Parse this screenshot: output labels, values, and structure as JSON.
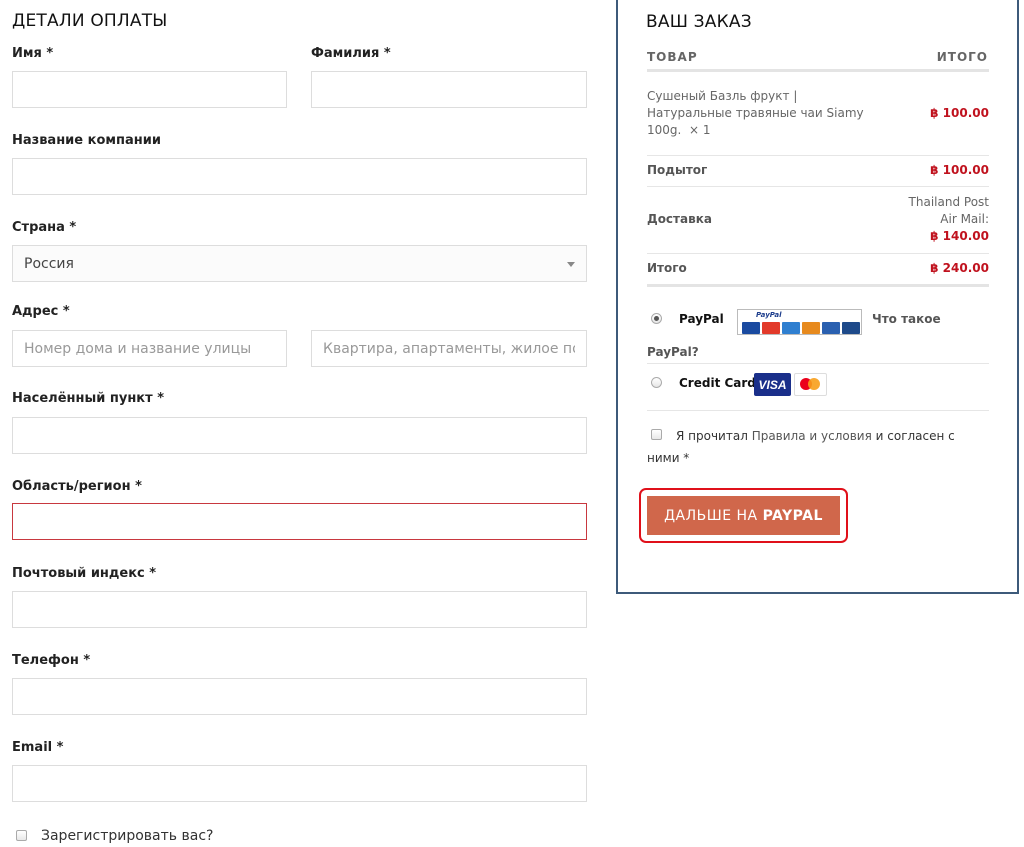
{
  "billing": {
    "title": "ДЕТАЛИ ОПЛАТЫ",
    "first_name_label": "Имя *",
    "last_name_label": "Фамилия *",
    "company_label": "Название компании",
    "country_label": "Страна *",
    "country_value": "Россия",
    "address_label": "Адрес *",
    "address1_placeholder": "Номер дома и название улицы",
    "address2_placeholder": "Квартира, апартаменты, жилое пом",
    "city_label": "Населённый пункт *",
    "region_label": "Область/регион *",
    "postcode_label": "Почтовый индекс *",
    "phone_label": "Телефон *",
    "email_label": "Email *",
    "register_label": "Зарегистрировать вас?"
  },
  "order": {
    "title": "ВАШ ЗАКАЗ",
    "col_product": "ТОВАР",
    "col_total": "ИТОГО",
    "item_line1": "Сушеный Базль фрукт |",
    "item_line2": "Натуральные травяные чаи Siamy",
    "item_line3": "100g.",
    "item_qty": "× 1",
    "item_price": "฿ 100.00",
    "subtotal_label": "Подытог",
    "subtotal_value": "฿ 100.00",
    "shipping_label": "Доставка",
    "shipping_method_line1": "Thailand Post",
    "shipping_method_line2": "Air Mail:",
    "shipping_value": "฿ 140.00",
    "total_label": "Итого",
    "total_value": "฿ 240.00"
  },
  "payment": {
    "paypal_label": "PayPal",
    "paypal_logo_text": "PayPal",
    "paypal_whatis_1": "Что такое",
    "paypal_whatis_2": "PayPal?",
    "credit_label": "Credit Card",
    "visa_text": "VISA",
    "terms_prefix": "Я прочитал",
    "terms_link": "Правила и условия",
    "terms_middle": "и согласен с",
    "terms_suffix": "ними *",
    "button_prefix": "ДАЛЬШЕ НА",
    "button_bold": "PAYPAL"
  },
  "colors": {
    "button_bg": "#d0674b",
    "price_red": "#c0121e",
    "panel_border": "#3d5a7a",
    "highlight_red": "#e0101a",
    "error_border": "#c8383f"
  }
}
